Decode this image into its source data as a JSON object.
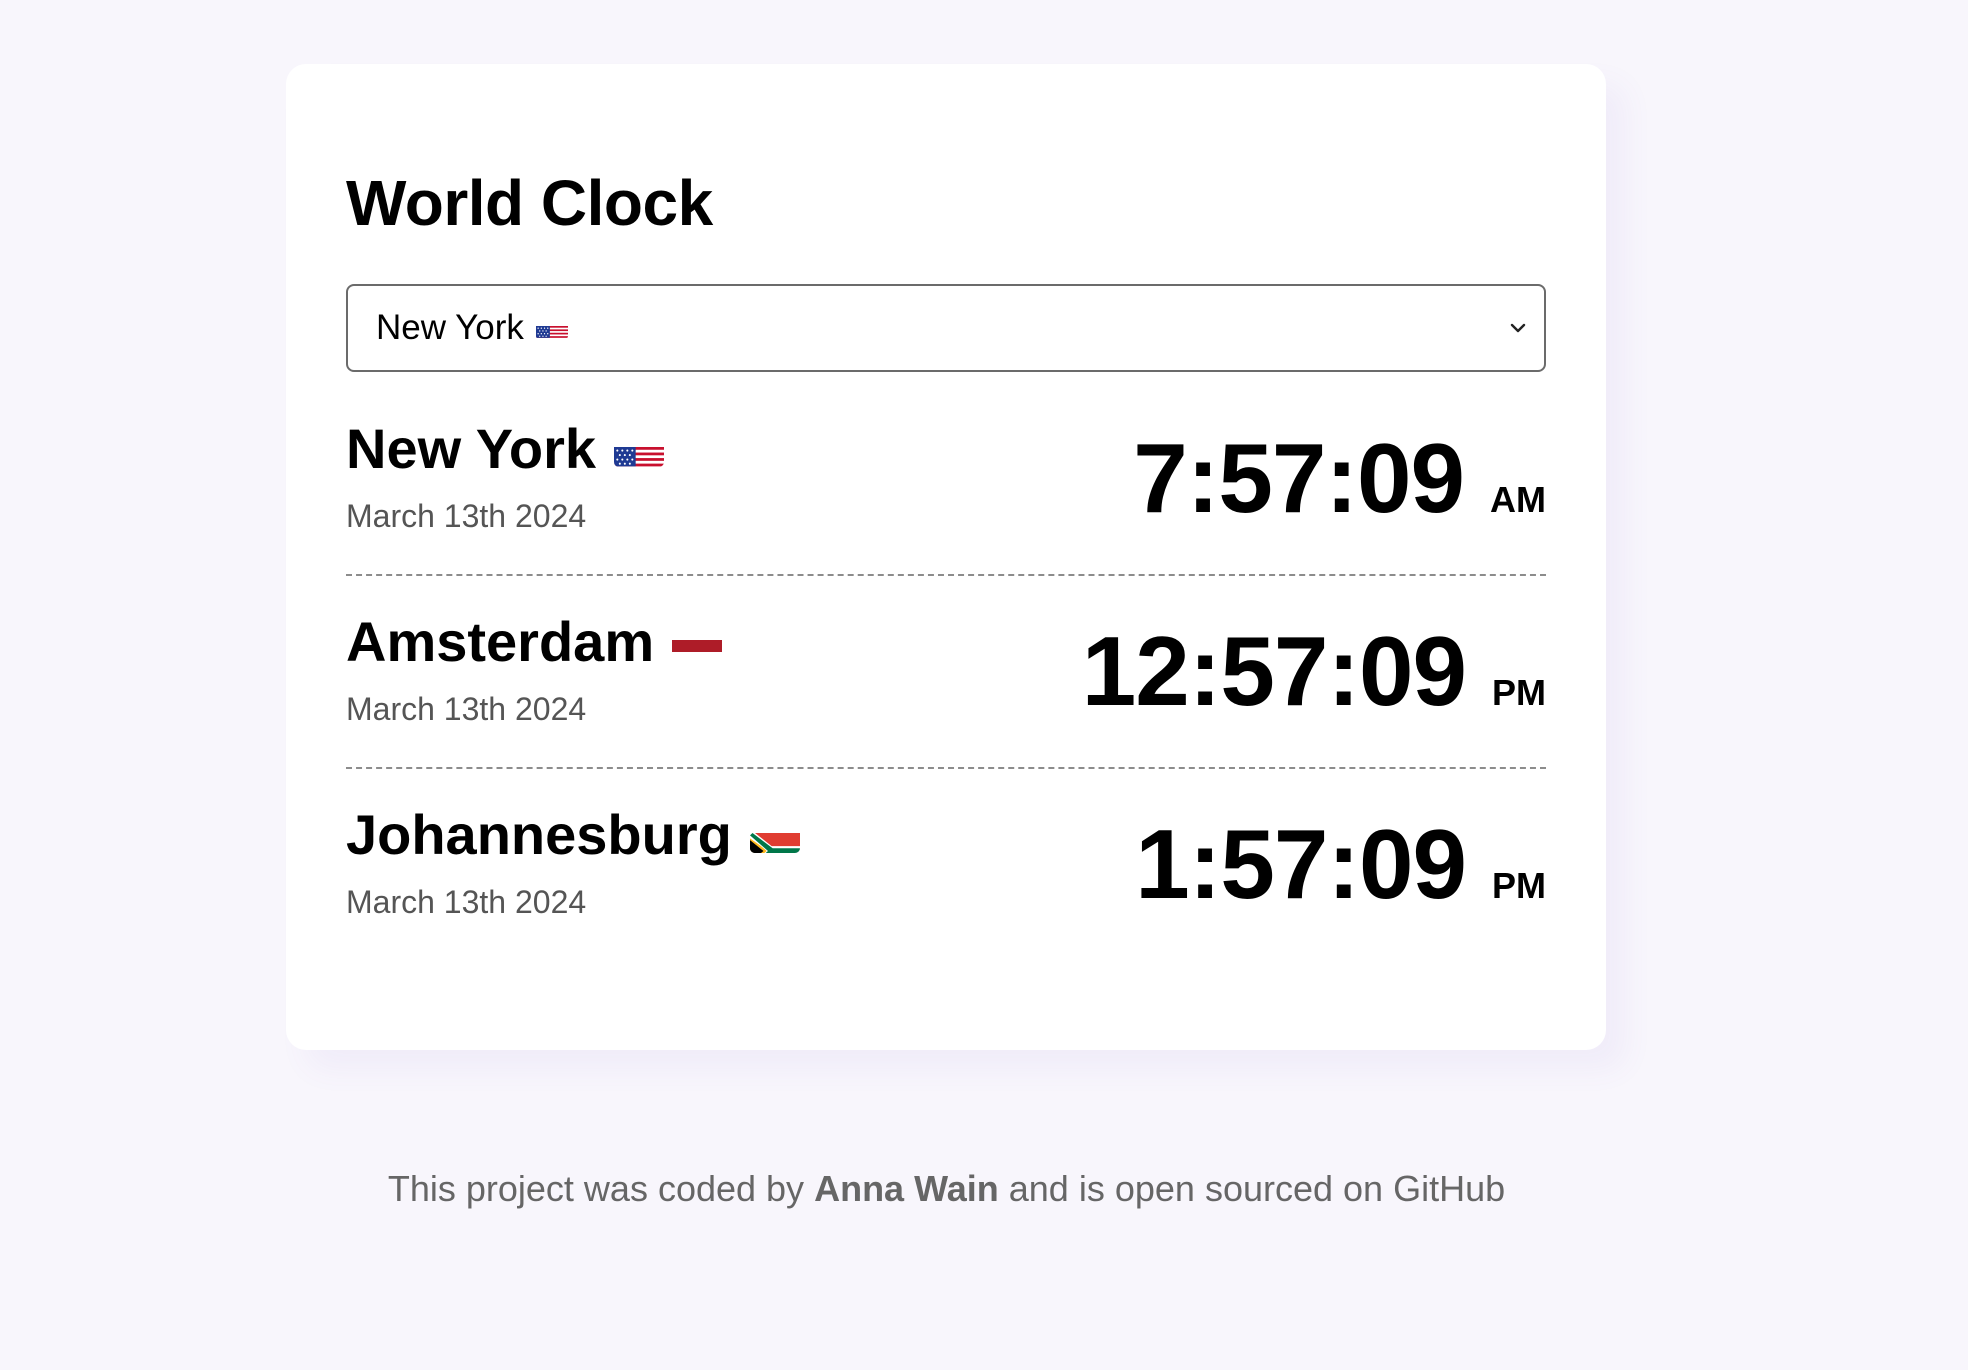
{
  "title": "World Clock",
  "select": {
    "selected": "New York",
    "selected_flag": "us-flag-icon"
  },
  "cities": [
    {
      "name": "New York",
      "flag": "us-flag-icon",
      "date": "March 13th 2024",
      "time": "7:57:09",
      "ampm": "AM"
    },
    {
      "name": "Amsterdam",
      "flag": "nl-flag-icon",
      "date": "March 13th 2024",
      "time": "12:57:09",
      "ampm": "PM"
    },
    {
      "name": "Johannesburg",
      "flag": "za-flag-icon",
      "date": "March 13th 2024",
      "time": "1:57:09",
      "ampm": "PM"
    }
  ],
  "footer": {
    "prefix": "This project was coded by",
    "author": "Anna Wain",
    "middle": "and is",
    "link": "open sourced on GitHub"
  },
  "colors": {
    "background": "#f8f6fc",
    "card": "#ffffff",
    "date_text": "#555555",
    "footer_text": "#666666"
  }
}
